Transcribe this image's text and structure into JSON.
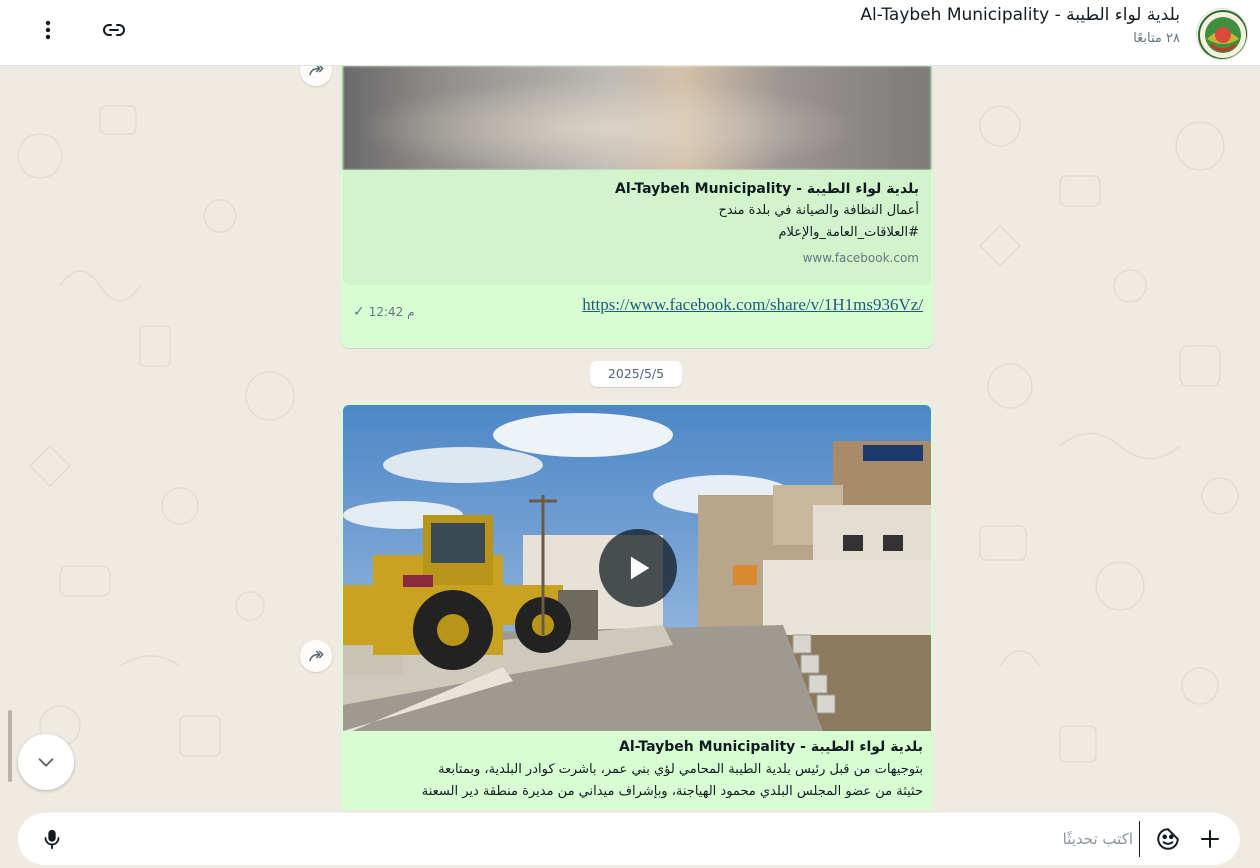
{
  "header": {
    "channel_name": "بلدية لواء الطيبة - Al-Taybeh Municipality",
    "followers": "٢٨ متابعًا",
    "menu_icon": "more-vertical-icon",
    "link_icon": "link-icon"
  },
  "messages": [
    {
      "preview_title": "بلدية لواء الطيبة - Al-Taybeh Municipality",
      "preview_line1": "أعمال النظافة والصيانة في بلدة مندح",
      "preview_line2": "#العلاقات_العامة_والإعلام",
      "preview_domain": "www.facebook.com",
      "link": "https://www.facebook.com/share/v/1H1ms936Vz/",
      "time": "12:42 م",
      "status": "sent"
    },
    {
      "date_separator": "2025/5/5",
      "caption_title": "بلدية لواء الطيبة - Al-Taybeh Municipality",
      "caption_line1": "بتوجيهات من قبل رئيس بلدية الطيبة المحامي لؤي بني عمر، باشرت كوادر البلدية، وبمتابعة",
      "caption_line2": "حثيثة من عضو المجلس البلدي محمود الهياجنة، وبإشراف ميداني من مديرة منطقة دير السعنة"
    }
  ],
  "footer": {
    "input_placeholder": "اكتب تحديثًا",
    "mic_icon": "microphone-icon",
    "emoji_icon": "sticker-icon",
    "plus_icon": "plus-icon"
  },
  "colors": {
    "bubble": "#d9fdd3",
    "link_preview": "#d1f4cc",
    "background": "#efeae2",
    "link": "#1e5a7a"
  }
}
